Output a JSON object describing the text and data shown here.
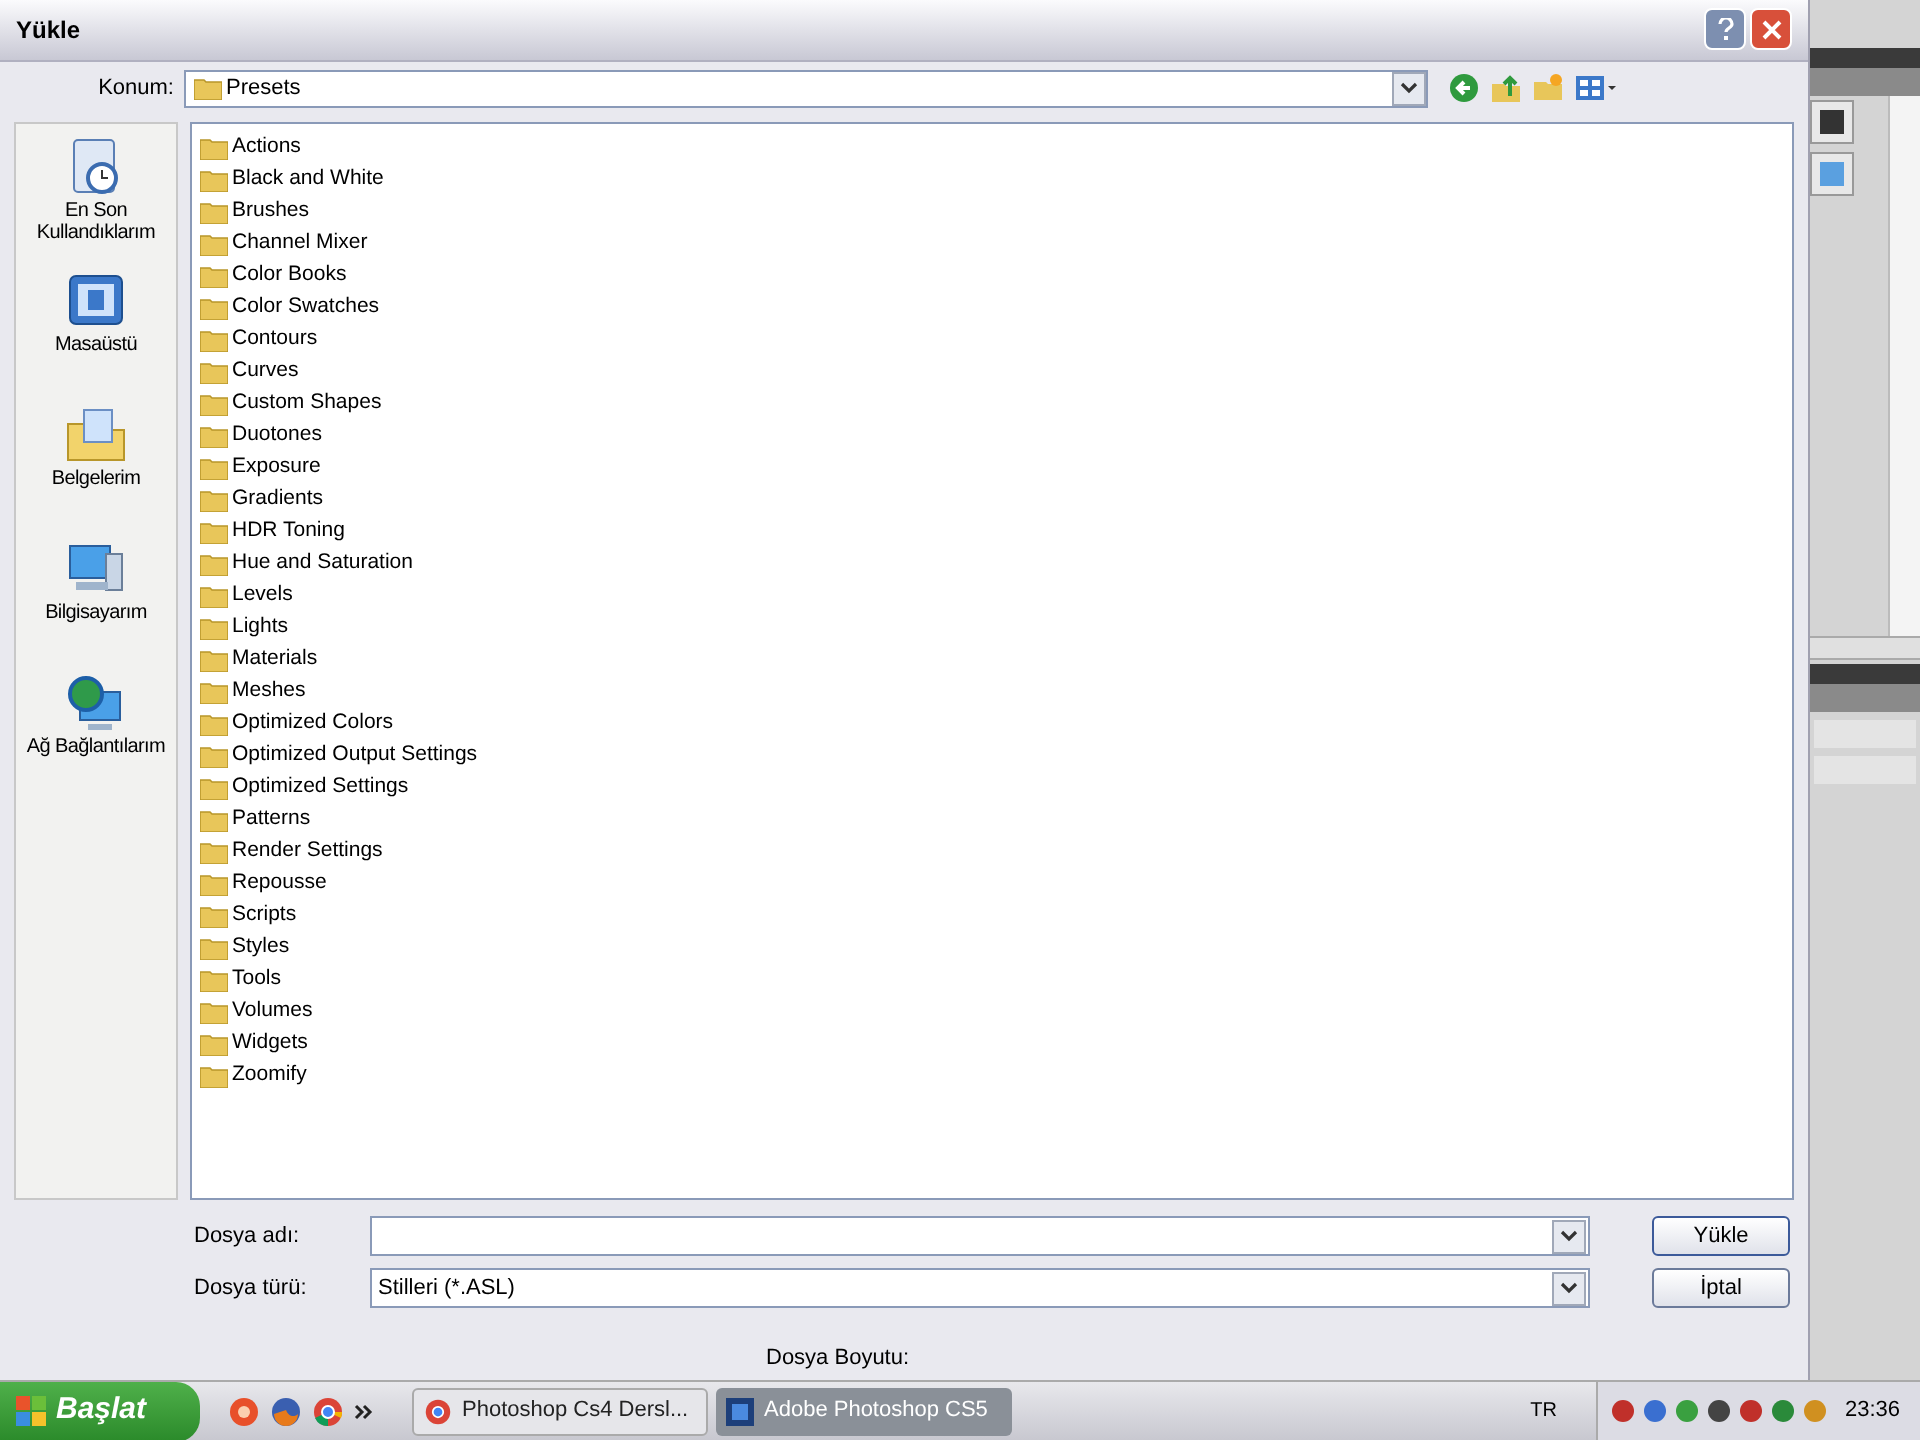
{
  "dialog": {
    "title": "Yükle",
    "location_label": "Konum:",
    "location": "Presets",
    "places": [
      {
        "kind": "recent",
        "label": "En Son Kullandıklarım"
      },
      {
        "kind": "desktop",
        "label": "Masaüstü"
      },
      {
        "kind": "documents",
        "label": "Belgelerim"
      },
      {
        "kind": "computer",
        "label": "Bilgisayarım"
      },
      {
        "kind": "network",
        "label": "Ağ Bağlantılarım"
      }
    ],
    "folders": [
      "Actions",
      "Black and White",
      "Brushes",
      "Channel Mixer",
      "Color Books",
      "Color Swatches",
      "Contours",
      "Curves",
      "Custom Shapes",
      "Duotones",
      "Exposure",
      "Gradients",
      "HDR Toning",
      "Hue and Saturation",
      "Levels",
      "Lights",
      "Materials",
      "Meshes",
      "Optimized Colors",
      "Optimized Output Settings",
      "Optimized Settings",
      "Patterns",
      "Render Settings",
      "Repousse",
      "Scripts",
      "Styles",
      "Tools",
      "Volumes",
      "Widgets",
      "Zoomify"
    ],
    "file_name_label": "Dosya adı:",
    "file_type_label": "Dosya türü:",
    "file_type": "Stilleri (*.ASL)",
    "open_button": "Yükle",
    "cancel_button": "İptal",
    "file_size_label": "Dosya Boyutu:"
  },
  "taskbar": {
    "start": "Başlat",
    "tasks": [
      {
        "label": "Photoshop Cs4 Dersl...",
        "selected": false
      },
      {
        "label": "Adobe Photoshop CS5",
        "selected": true
      }
    ],
    "language": "TR",
    "clock": "23:36"
  }
}
